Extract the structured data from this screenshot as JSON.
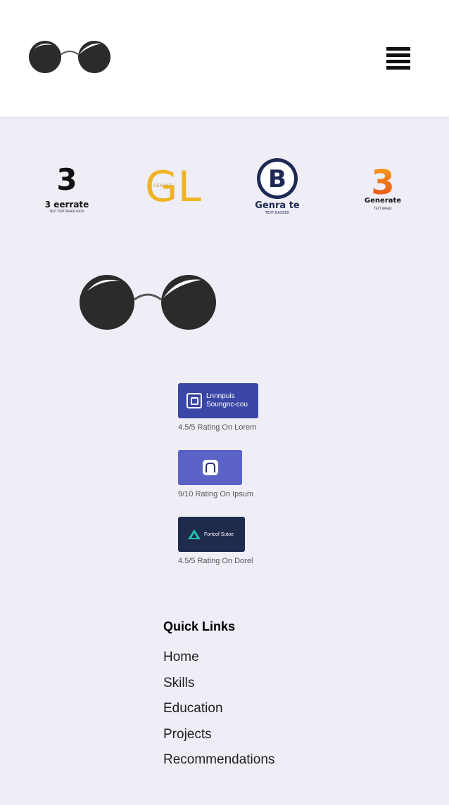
{
  "header": {
    "menu_icon": "hamburger-menu-icon",
    "logo_icon": "glasses-logo-icon"
  },
  "partners": [
    {
      "name": "3 eerrate",
      "tagline": "TEXT TEXT BASED LOGO"
    },
    {
      "name": "GL",
      "tagline": "GENRATE"
    },
    {
      "name": "Genra te",
      "tagline": "TEXT BASSED"
    },
    {
      "name": "Generate",
      "tagline": "TEXT BASED"
    }
  ],
  "ratings": [
    {
      "badge_line1": "Lnnnpuis",
      "badge_line2": "Soungnc-cou",
      "text": "4.5/5 Rating On Lorem",
      "color": "#3b47a6"
    },
    {
      "badge_icon": "n-logo-icon",
      "text": "9/10 Rating On Ipsum",
      "color": "#5a62c6"
    },
    {
      "badge_label": "Fortcof Sutoe",
      "text": "4.5/5 Rating On Dorel",
      "color": "#1f2b4d"
    }
  ],
  "footer": {
    "title": "Quick Links",
    "links": [
      "Home",
      "Skills",
      "Education",
      "Projects",
      "Recommendations"
    ]
  }
}
